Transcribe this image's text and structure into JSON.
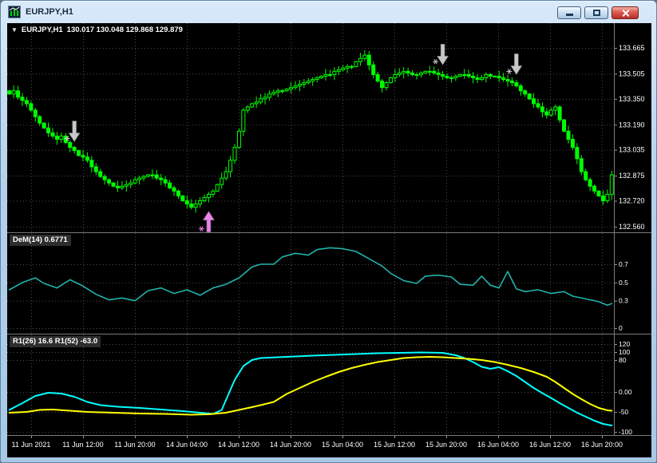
{
  "window": {
    "title": "EURJPY,H1"
  },
  "legend": {
    "collapse_icon": "▼",
    "symbol": "EURJPY,H1",
    "ohlc": "130.017 130.048 129.868 129.879"
  },
  "indicators": {
    "dem_label": "DeM(14) 0.6771",
    "r1_label": "R1(26) 16.6  R1(52) -63.0"
  },
  "colors": {
    "background": "#000000",
    "grid": "#4a4a4a",
    "axis_text": "#ffffff",
    "separator": "#7a7a7a",
    "bull_candle": "#00ff00",
    "bear_candle": "#00ff00",
    "dem_line": "#20b2aa",
    "r1_fast_line": "#00ffff",
    "r1_slow_line": "#ffff00",
    "sell_arrow": "#c8c8c8",
    "buy_arrow": "#ee82ee"
  },
  "chart_data": [
    {
      "type": "candlestick",
      "title": "EURJPY H1 price panel",
      "x_tick_labels": [
        "11 Jun 2021",
        "11 Jun 12:00",
        "11 Jun 20:00",
        "14 Jun 04:00",
        "14 Jun 12:00",
        "14 Jun 20:00",
        "15 Jun 04:00",
        "15 Jun 12:00",
        "15 Jun 20:00",
        "16 Jun 04:00",
        "16 Jun 12:00",
        "16 Jun 20:00"
      ],
      "y_tick_labels": [
        "133.665",
        "133.505",
        "133.350",
        "133.190",
        "133.035",
        "132.875",
        "132.720",
        "132.560"
      ],
      "ylim": [
        132.525,
        133.818
      ],
      "closes": [
        133.38,
        133.4,
        133.36,
        133.34,
        133.32,
        133.28,
        133.24,
        133.2,
        133.17,
        133.14,
        133.12,
        133.1,
        133.12,
        133.08,
        133.05,
        133.03,
        133.0,
        132.99,
        132.97,
        132.93,
        132.9,
        132.87,
        132.85,
        132.83,
        132.81,
        132.8,
        132.81,
        132.82,
        132.83,
        132.85,
        132.86,
        132.87,
        132.88,
        132.88,
        132.86,
        132.85,
        132.83,
        132.8,
        132.78,
        132.75,
        132.72,
        132.7,
        132.68,
        132.7,
        132.72,
        132.74,
        132.76,
        132.78,
        132.82,
        132.86,
        132.9,
        132.97,
        133.05,
        133.15,
        133.28,
        133.3,
        133.32,
        133.33,
        133.35,
        133.36,
        133.38,
        133.39,
        133.4,
        133.4,
        133.41,
        133.42,
        133.43,
        133.44,
        133.45,
        133.46,
        133.47,
        133.48,
        133.49,
        133.5,
        133.5,
        133.52,
        133.53,
        133.54,
        133.55,
        133.55,
        133.58,
        133.6,
        133.62,
        133.56,
        133.5,
        133.46,
        133.42,
        133.45,
        133.48,
        133.5,
        133.51,
        133.52,
        133.51,
        133.5,
        133.5,
        133.51,
        133.52,
        133.52,
        133.51,
        133.5,
        133.49,
        133.48,
        133.48,
        133.49,
        133.5,
        133.5,
        133.49,
        133.48,
        133.47,
        133.48,
        133.5,
        133.49,
        133.49,
        133.48,
        133.47,
        133.46,
        133.45,
        133.43,
        133.4,
        133.38,
        133.35,
        133.32,
        133.3,
        133.27,
        133.25,
        133.28,
        133.3,
        133.22,
        133.15,
        133.1,
        133.05,
        132.98,
        132.9,
        132.85,
        132.81,
        132.78,
        132.75,
        132.72,
        132.76,
        132.88
      ],
      "annotations": {
        "arrows": [
          {
            "dir": "down",
            "index": 15,
            "price": 133.085,
            "color": "#c8c8c8"
          },
          {
            "dir": "up",
            "index": 46,
            "price": 132.655,
            "color": "#ee82ee"
          },
          {
            "dir": "down",
            "index": 100,
            "price": 133.56,
            "color": "#c8c8c8"
          },
          {
            "dir": "down",
            "index": 117,
            "price": 133.5,
            "color": "#c8c8c8"
          }
        ]
      }
    },
    {
      "type": "line",
      "title": "DeM(14)",
      "y_tick_labels": [
        "0.7",
        "0.5",
        "0.3",
        "0"
      ],
      "ylim": [
        -0.061,
        1.041
      ],
      "series": [
        {
          "name": "DeM(14)",
          "color": "#20b2aa",
          "points": [
            [
              0,
              0.42
            ],
            [
              3,
              0.5
            ],
            [
              6,
              0.55
            ],
            [
              8,
              0.49
            ],
            [
              11,
              0.44
            ],
            [
              14,
              0.53
            ],
            [
              17,
              0.46
            ],
            [
              20,
              0.37
            ],
            [
              23,
              0.31
            ],
            [
              26,
              0.33
            ],
            [
              29,
              0.3
            ],
            [
              32,
              0.41
            ],
            [
              35,
              0.44
            ],
            [
              38,
              0.38
            ],
            [
              41,
              0.42
            ],
            [
              44,
              0.36
            ],
            [
              47,
              0.44
            ],
            [
              50,
              0.48
            ],
            [
              53,
              0.55
            ],
            [
              56,
              0.67
            ],
            [
              58,
              0.7
            ],
            [
              61,
              0.7
            ],
            [
              63,
              0.78
            ],
            [
              66,
              0.82
            ],
            [
              69,
              0.8
            ],
            [
              71,
              0.86
            ],
            [
              74,
              0.88
            ],
            [
              77,
              0.87
            ],
            [
              80,
              0.84
            ],
            [
              83,
              0.76
            ],
            [
              86,
              0.68
            ],
            [
              88,
              0.6
            ],
            [
              91,
              0.52
            ],
            [
              94,
              0.49
            ],
            [
              96,
              0.57
            ],
            [
              99,
              0.58
            ],
            [
              102,
              0.56
            ],
            [
              104,
              0.48
            ],
            [
              107,
              0.47
            ],
            [
              109,
              0.57
            ],
            [
              111,
              0.47
            ],
            [
              113,
              0.44
            ],
            [
              115,
              0.62
            ],
            [
              117,
              0.43
            ],
            [
              119,
              0.4
            ],
            [
              122,
              0.42
            ],
            [
              125,
              0.38
            ],
            [
              128,
              0.4
            ],
            [
              130,
              0.35
            ],
            [
              133,
              0.32
            ],
            [
              136,
              0.29
            ],
            [
              138,
              0.25
            ],
            [
              139,
              0.27
            ]
          ]
        }
      ]
    },
    {
      "type": "line",
      "title": "R1",
      "y_tick_labels": [
        "120",
        "100",
        "80",
        "0.00",
        "-50",
        "-100"
      ],
      "ylim": [
        -108,
        144
      ],
      "series": [
        {
          "name": "R1(26)",
          "color": "#00ffff",
          "points": [
            [
              0,
              -45
            ],
            [
              3,
              -28
            ],
            [
              6,
              -10
            ],
            [
              9,
              -2
            ],
            [
              12,
              -4
            ],
            [
              15,
              -12
            ],
            [
              18,
              -25
            ],
            [
              21,
              -33
            ],
            [
              25,
              -37
            ],
            [
              30,
              -40
            ],
            [
              35,
              -44
            ],
            [
              40,
              -48
            ],
            [
              44,
              -52
            ],
            [
              47,
              -55
            ],
            [
              49,
              -45
            ],
            [
              50,
              -20
            ],
            [
              52,
              30
            ],
            [
              54,
              65
            ],
            [
              56,
              80
            ],
            [
              58,
              85
            ],
            [
              62,
              87
            ],
            [
              66,
              89
            ],
            [
              70,
              91
            ],
            [
              75,
              93
            ],
            [
              80,
              95
            ],
            [
              85,
              97
            ],
            [
              90,
              98
            ],
            [
              95,
              99
            ],
            [
              100,
              98
            ],
            [
              103,
              92
            ],
            [
              105,
              85
            ],
            [
              107,
              75
            ],
            [
              109,
              63
            ],
            [
              111,
              58
            ],
            [
              113,
              62
            ],
            [
              115,
              52
            ],
            [
              117,
              40
            ],
            [
              119,
              25
            ],
            [
              121,
              10
            ],
            [
              123,
              -3
            ],
            [
              125,
              -15
            ],
            [
              127,
              -28
            ],
            [
              129,
              -40
            ],
            [
              131,
              -52
            ],
            [
              133,
              -62
            ],
            [
              135,
              -72
            ],
            [
              137,
              -80
            ],
            [
              139,
              -84
            ]
          ]
        },
        {
          "name": "R1(52)",
          "color": "#ffff00",
          "points": [
            [
              0,
              -52
            ],
            [
              4,
              -50
            ],
            [
              7,
              -45
            ],
            [
              10,
              -44
            ],
            [
              14,
              -47
            ],
            [
              18,
              -50
            ],
            [
              24,
              -52
            ],
            [
              30,
              -54
            ],
            [
              36,
              -55
            ],
            [
              42,
              -57
            ],
            [
              46,
              -56
            ],
            [
              50,
              -52
            ],
            [
              53,
              -45
            ],
            [
              56,
              -38
            ],
            [
              58,
              -33
            ],
            [
              61,
              -25
            ],
            [
              64,
              -5
            ],
            [
              67,
              10
            ],
            [
              70,
              25
            ],
            [
              73,
              38
            ],
            [
              76,
              50
            ],
            [
              79,
              60
            ],
            [
              82,
              68
            ],
            [
              85,
              75
            ],
            [
              88,
              80
            ],
            [
              91,
              85
            ],
            [
              94,
              87
            ],
            [
              97,
              88
            ],
            [
              100,
              87
            ],
            [
              103,
              85
            ],
            [
              106,
              83
            ],
            [
              109,
              80
            ],
            [
              112,
              75
            ],
            [
              115,
              68
            ],
            [
              118,
              60
            ],
            [
              121,
              50
            ],
            [
              124,
              38
            ],
            [
              126,
              25
            ],
            [
              128,
              10
            ],
            [
              130,
              -5
            ],
            [
              132,
              -18
            ],
            [
              134,
              -30
            ],
            [
              136,
              -40
            ],
            [
              138,
              -46
            ],
            [
              139,
              -47
            ]
          ]
        }
      ]
    }
  ]
}
